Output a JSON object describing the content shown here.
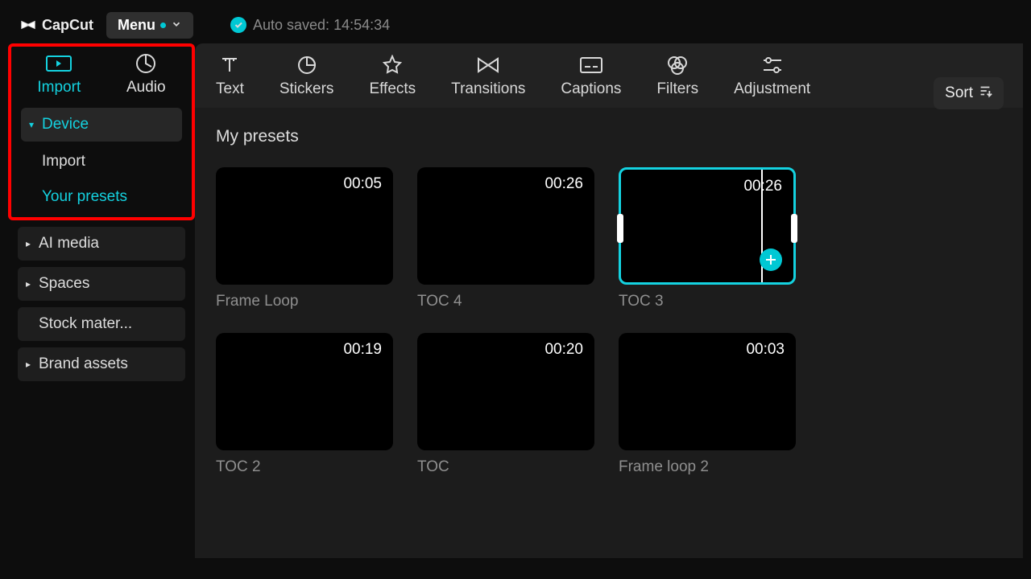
{
  "header": {
    "brand": "CapCut",
    "menu_label": "Menu",
    "autosave_label": "Auto saved: 14:54:34"
  },
  "primary_tabs": {
    "import": "Import",
    "audio": "Audio"
  },
  "secondary_tabs": {
    "text": "Text",
    "stickers": "Stickers",
    "effects": "Effects",
    "transitions": "Transitions",
    "captions": "Captions",
    "filters": "Filters",
    "adjustment": "Adjustment"
  },
  "sidebar": {
    "device": "Device",
    "device_import": "Import",
    "device_your_presets": "Your presets",
    "ai_media": "AI media",
    "spaces": "Spaces",
    "stock_materials": "Stock mater...",
    "brand_assets": "Brand assets"
  },
  "content": {
    "section_title": "My presets",
    "sort_label": "Sort"
  },
  "presets": [
    {
      "duration": "00:05",
      "label": "Frame Loop",
      "selected": false
    },
    {
      "duration": "00:26",
      "label": "TOC 4",
      "selected": false
    },
    {
      "duration": "00:26",
      "label": "TOC 3",
      "selected": true
    },
    {
      "duration": "00:19",
      "label": "TOC 2",
      "selected": false
    },
    {
      "duration": "00:20",
      "label": "TOC",
      "selected": false
    },
    {
      "duration": "00:03",
      "label": "Frame loop 2",
      "selected": false
    }
  ]
}
